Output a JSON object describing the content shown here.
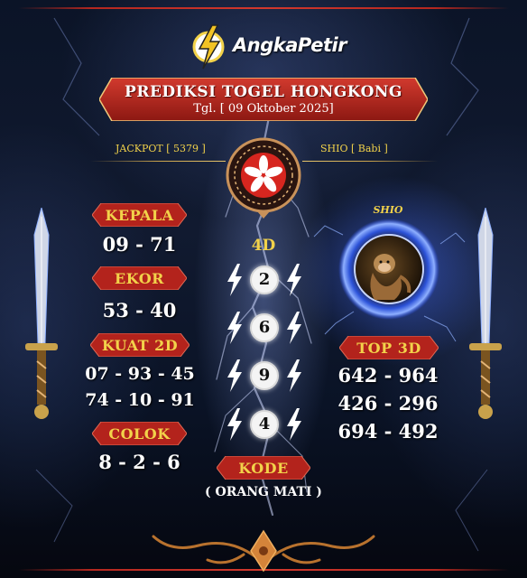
{
  "brand": {
    "logo_text": "AngkaPetir"
  },
  "header": {
    "title": "PREDIKSI TOGEL HONGKONG",
    "date": "Tgl. [ 09 Oktober 2025]"
  },
  "info": {
    "jackpot": "JACKPOT [ 5379 ]",
    "shio": "SHIO [ Babi ]"
  },
  "left": {
    "kepala_label": "KEPALA",
    "kepala_value": "09 - 71",
    "ekor_label": "EKOR",
    "ekor_value": "53 - 40",
    "kuat2d_label": "KUAT 2D",
    "kuat2d_line1": "07 - 93 - 45",
    "kuat2d_line2": "74 - 10 - 91",
    "colok_label": "COLOK",
    "colok_value": "8 - 2 - 6"
  },
  "center": {
    "label_4d": "4D",
    "digits": [
      "2",
      "6",
      "9",
      "4"
    ],
    "kode_label": "KODE",
    "kode_value": "( ORANG MATI )"
  },
  "right": {
    "shio_label": "SHIO",
    "top3d_label": "TOP 3D",
    "top3d_line1": "642 - 964",
    "top3d_line2": "426 - 296",
    "top3d_line3": "694 - 492"
  },
  "colors": {
    "accent_gold": "#f2d24a",
    "ribbon_red": "#b3231c",
    "frame_red": "#c8302a",
    "background": "#0b1427"
  },
  "icons": [
    "lightning-logo-icon",
    "hongkong-flag-emblem",
    "lightning-bolt-icon",
    "shio-monkey-orb",
    "sword-ornament",
    "bottom-scroll-ornament"
  ]
}
